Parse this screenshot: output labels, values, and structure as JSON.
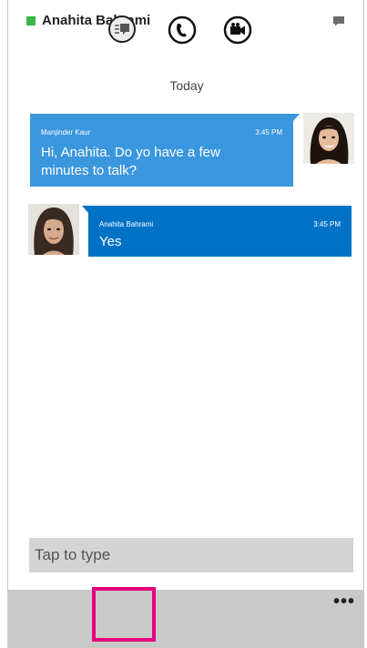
{
  "header": {
    "contact_name": "Anahita Bahrami",
    "presence_color": "#39b54a"
  },
  "conversation": {
    "date_label": "Today",
    "messages": [
      {
        "sender": "Manjinder Kaur",
        "time": "3:45 PM",
        "text": "Hi, Anahita. Do yo have a few minutes to talk?",
        "direction": "incoming",
        "color": "#3a96dd"
      },
      {
        "sender": "Anahita Bahrami",
        "time": "3:45 PM",
        "text": "Yes",
        "direction": "outgoing",
        "color": "#0072c6"
      }
    ]
  },
  "compose": {
    "placeholder": "Tap to type"
  },
  "appbar": {
    "buttons": [
      {
        "icon": "im-icon",
        "highlighted": true
      },
      {
        "icon": "phone-icon"
      },
      {
        "icon": "video-icon"
      }
    ],
    "more_label": "•••",
    "highlight_color": "#e5007e"
  }
}
